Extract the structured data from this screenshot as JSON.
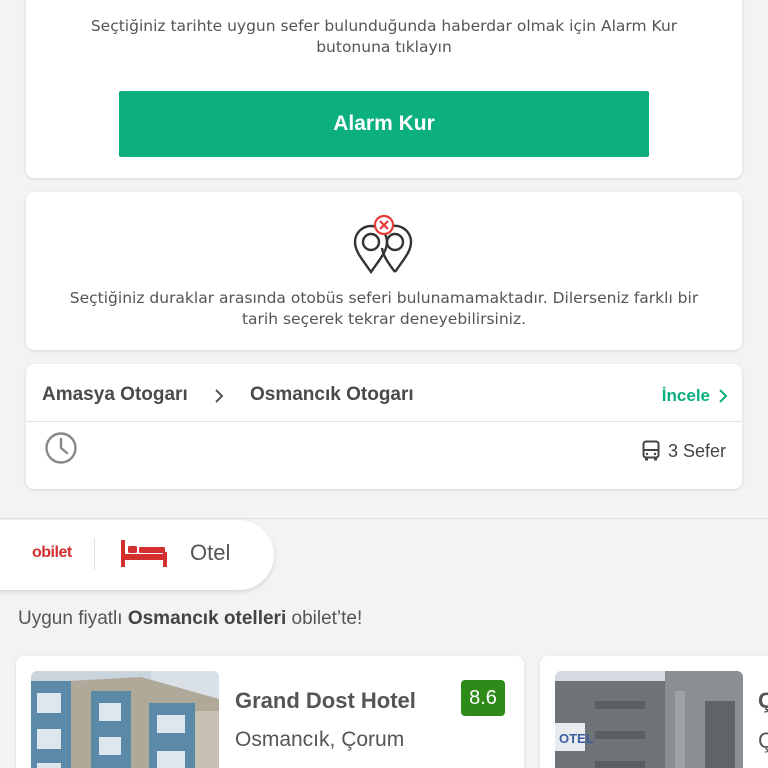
{
  "alarm": {
    "message": "Seçtiğiniz tarihte uygun sefer bulunduğunda haberdar olmak için Alarm Kur butonuna tıklayın",
    "button_label": "Alarm Kur",
    "button_color": "#0bb07e"
  },
  "no_result": {
    "icon": "map-pins-error-icon",
    "message": "Seçtiğiniz duraklar arasında otobüs seferi bulunamamaktadır. Dilerseniz farklı bir tarih seçerek tekrar deneyebilirsiniz."
  },
  "route": {
    "from": "Amasya Otogarı",
    "to": "Osmancık Otogarı",
    "inspect_label": "İncele",
    "trips_count": "3 Sefer"
  },
  "tabs": {
    "brand": "obilet",
    "otel_label": "Otel",
    "brand_color": "#d32f2f"
  },
  "promo": {
    "prefix": "Uygun fiyatlı ",
    "highlight": "Osmancık otelleri",
    "suffix": " obilet’te!"
  },
  "hotels": [
    {
      "name": "Grand Dost Hotel",
      "location": "Osmancık, Çorum",
      "rating": "8.6"
    },
    {
      "name_partial": "Ç",
      "location_partial": "Ç"
    }
  ],
  "colors": {
    "accent": "#0bb07e",
    "rating_green": "#2e8b1a"
  }
}
